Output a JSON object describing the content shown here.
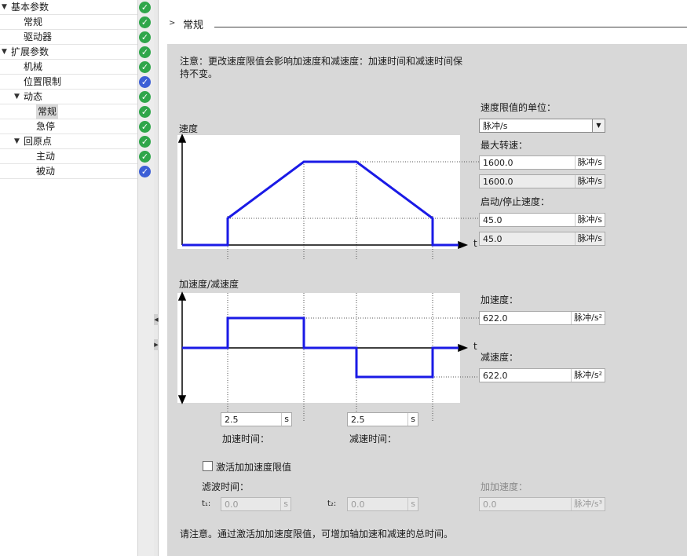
{
  "tree": [
    {
      "label": "基本参数",
      "level": 0,
      "expanded": true,
      "status": "ok"
    },
    {
      "label": "常规",
      "level": 1,
      "status": "ok"
    },
    {
      "label": "驱动器",
      "level": 1,
      "status": "ok"
    },
    {
      "label": "扩展参数",
      "level": 0,
      "expanded": true,
      "status": "ok"
    },
    {
      "label": "机械",
      "level": 1,
      "status": "ok"
    },
    {
      "label": "位置限制",
      "level": 1,
      "status": "info"
    },
    {
      "label": "动态",
      "level": 1,
      "expanded": true,
      "status": "ok"
    },
    {
      "label": "常规",
      "level": 2,
      "status": "ok",
      "selected": true
    },
    {
      "label": "急停",
      "level": 2,
      "status": "ok"
    },
    {
      "label": "回原点",
      "level": 1,
      "expanded": true,
      "status": "ok"
    },
    {
      "label": "主动",
      "level": 2,
      "status": "ok"
    },
    {
      "label": "被动",
      "level": 2,
      "status": "info"
    }
  ],
  "section_title": "常规",
  "note": "注意：更改速度限值会影响加速度和减速度：加速时间和减速时间保持不变。",
  "speed_chart": {
    "title": "速度",
    "t_label": "t"
  },
  "accel_chart": {
    "title": "加速度/减速度",
    "t_label": "t"
  },
  "speed_unit": {
    "label": "速度限值的单位：",
    "selected": "脉冲/s"
  },
  "max_speed": {
    "label": "最大转速：",
    "value": "1600.0",
    "unit": "脉冲/s",
    "readonly_value": "1600.0",
    "readonly_unit": "脉冲/s"
  },
  "start_stop_speed": {
    "label": "启动/停止速度：",
    "value": "45.0",
    "unit": "脉冲/s",
    "readonly_value": "45.0",
    "readonly_unit": "脉冲/s"
  },
  "acceleration": {
    "label": "加速度：",
    "value": "622.0",
    "unit": "脉冲/s²"
  },
  "deceleration": {
    "label": "减速度：",
    "value": "622.0",
    "unit": "脉冲/s²"
  },
  "accel_time": {
    "label": "加速时间：",
    "value": "2.5",
    "unit": "s"
  },
  "decel_time": {
    "label": "减速时间：",
    "value": "2.5",
    "unit": "s"
  },
  "jerk": {
    "checkbox_label": "激活加加速度限值",
    "checked": false,
    "filter_label": "滤波时间：",
    "t1_label": "t₁:",
    "t1_value": "0.0",
    "t1_unit": "s",
    "t2_label": "t₂:",
    "t2_value": "0.0",
    "t2_unit": "s",
    "jerk_label": "加加速度：",
    "jerk_value": "0.0",
    "jerk_unit": "脉冲/s³"
  },
  "bottom_note": "请注意。通过激活加加速度限值，可增加轴加速和减速的总时间。",
  "colors": {
    "status_ok": "#2fa64a",
    "status_info": "#3c5fd6",
    "profile_line": "#1a1ae6",
    "panel_bg": "#d8d8d8"
  }
}
